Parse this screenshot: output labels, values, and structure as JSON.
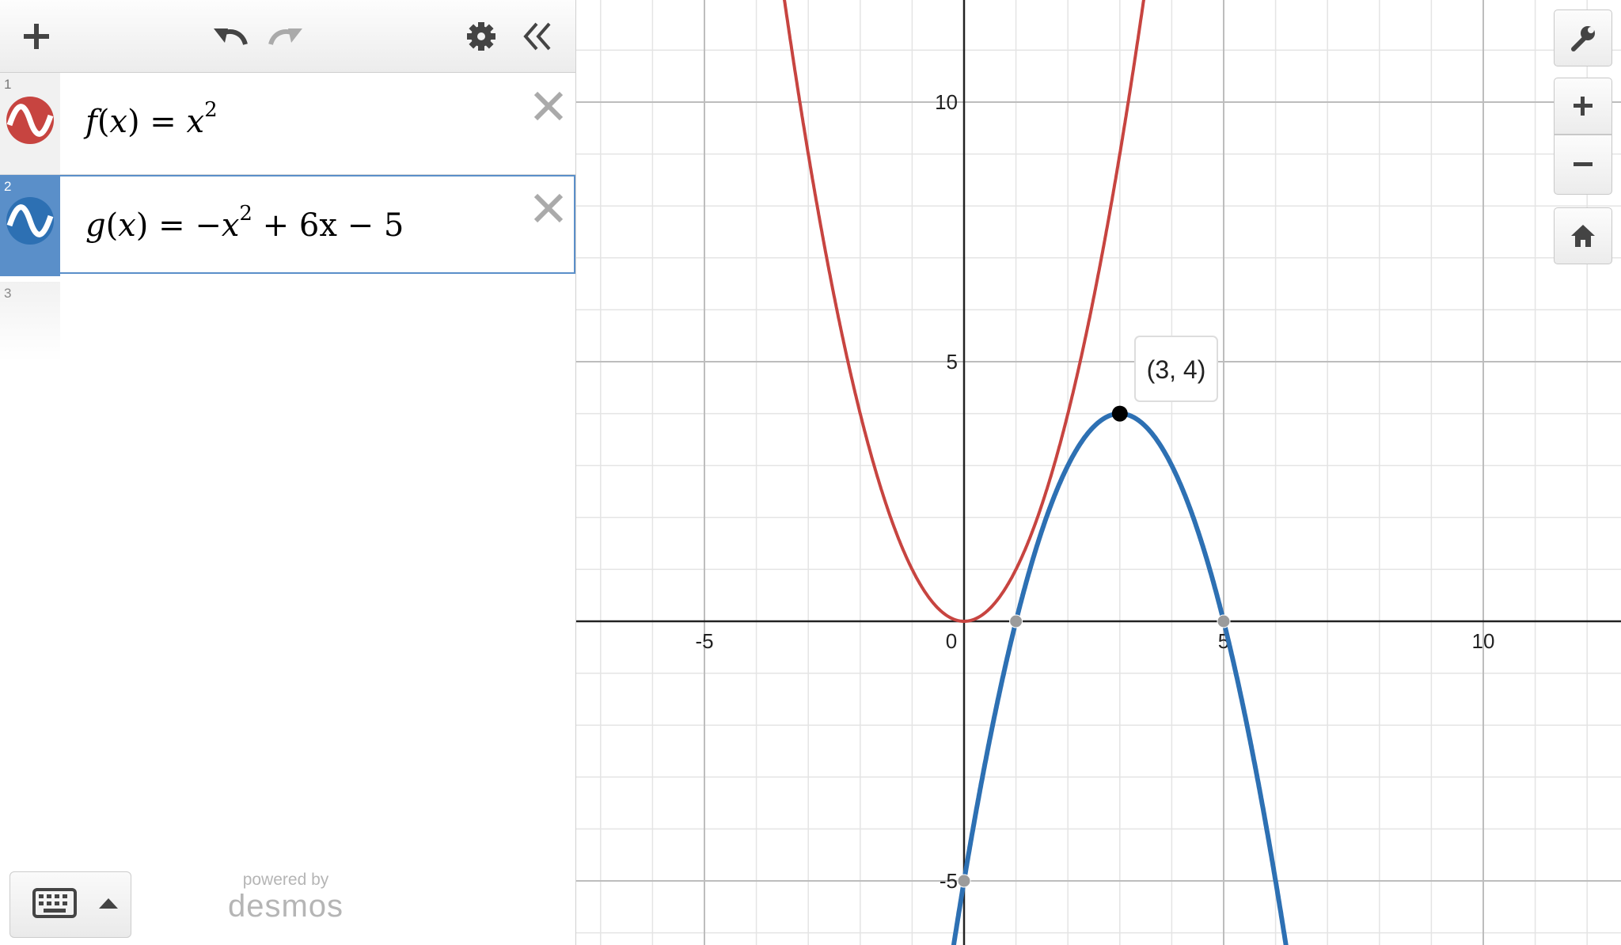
{
  "expressions": [
    {
      "index": "1",
      "name": "f",
      "arg": "x",
      "rhs": "x",
      "exp": "2",
      "color": "#c74440"
    },
    {
      "index": "2",
      "name": "g",
      "arg": "x",
      "rhs_parts": [
        "−x",
        "2",
        " + 6x − 5"
      ],
      "color": "#2d70b3"
    }
  ],
  "empty_row_index": "3",
  "graph": {
    "x_ticks": [
      "-5",
      "0",
      "5",
      "10"
    ],
    "y_ticks": [
      "10",
      "5",
      "-5"
    ],
    "point_label": "(3, 4)"
  },
  "branding": {
    "line1": "powered by",
    "line2": "desmos"
  },
  "colors": {
    "f": "#c74440",
    "g": "#2d70b3",
    "selected": "#5a8fc9"
  },
  "icons": [
    "add-icon",
    "undo-icon",
    "redo-icon",
    "gear-icon",
    "collapse-icon",
    "close-icon",
    "wrench-icon",
    "zoom-in-icon",
    "zoom-out-icon",
    "home-icon",
    "keyboard-icon",
    "caret-up-icon"
  ]
}
